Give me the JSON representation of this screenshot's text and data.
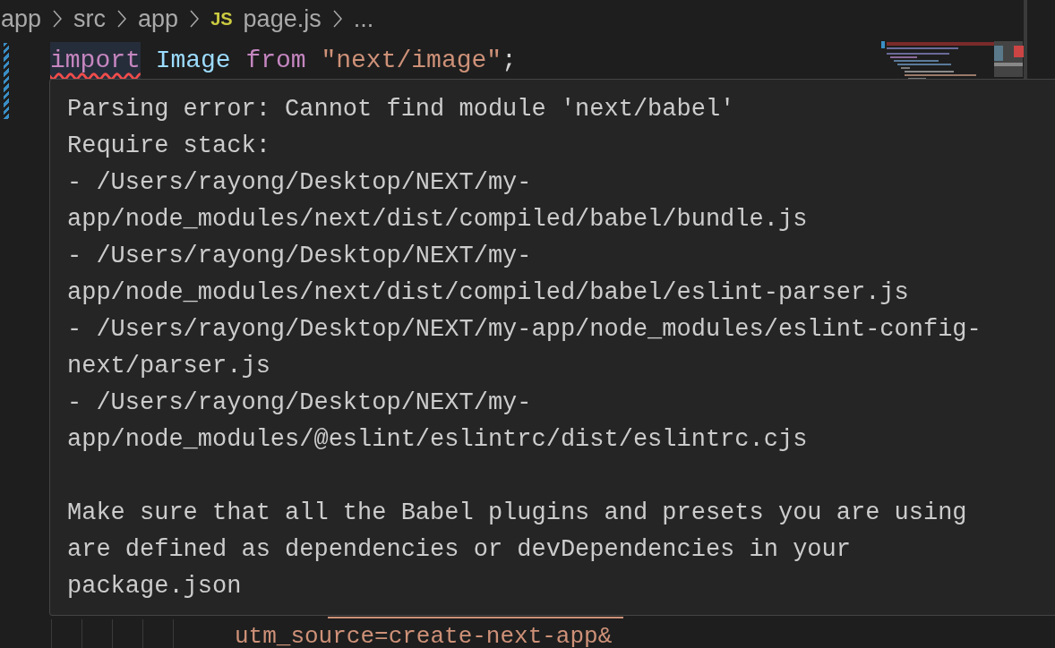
{
  "breadcrumb": [
    {
      "label": "app",
      "kind": "folder"
    },
    {
      "label": "src",
      "kind": "folder"
    },
    {
      "label": "app",
      "kind": "folder"
    },
    {
      "label": "page.js",
      "kind": "js",
      "badge": "JS"
    },
    {
      "label": "...",
      "kind": "more"
    }
  ],
  "code_line": [
    {
      "text": "import",
      "kind": "keyword",
      "error": true
    },
    {
      "text": "Image",
      "kind": "variable",
      "error": false
    },
    {
      "text": "from",
      "kind": "keyword",
      "error": false
    },
    {
      "text": "\"next/image\"",
      "kind": "string",
      "error": false
    },
    {
      "text": ";",
      "kind": "punct",
      "error": false
    }
  ],
  "hover_paragraphs": [
    [
      "Parsing error: Cannot find module 'next/babel'",
      "Require stack:",
      "- /Users/rayong/Desktop/NEXT/my-",
      "app/node_modules/next/dist/compiled/babel/bundle.js",
      "- /Users/rayong/Desktop/NEXT/my-",
      "app/node_modules/next/dist/compiled/babel/eslint-parser.js",
      "- /Users/rayong/Desktop/NEXT/my-app/node_modules/eslint-config-",
      "next/parser.js",
      "- /Users/rayong/Desktop/NEXT/my-",
      "app/node_modules/@eslint/eslintrc/dist/eslintrc.cjs"
    ],
    [
      "Make sure that all the Babel plugins and presets you are using",
      "are defined as dependencies or devDependencies in your",
      "package.json"
    ]
  ],
  "bottom_code": "utm_source=create-next-app&"
}
